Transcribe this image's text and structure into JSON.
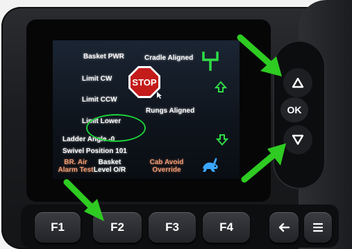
{
  "screen": {
    "labels": {
      "basket_pwr": "Basket PWR",
      "cradle_aligned": "Cradle Aligned",
      "limit_cw": "Limit CW",
      "limit_ccw": "Limit CCW",
      "limit_lower": "Limit Lower",
      "rungs_aligned": "Rungs Aligned",
      "ladder_angle": "Ladder Angle -0",
      "swivel_position": "Swivel Position 101",
      "stop_sign": "STOP"
    },
    "soft_keys": {
      "f1_line1": "BR. Air",
      "f1_line2": "Alarm Test",
      "f2_line1": "Basket",
      "f2_line2": "Level O/R",
      "f3_line1": "Cab Avoid",
      "f3_line2": "Override"
    }
  },
  "nav": {
    "ok": "OK"
  },
  "function_keys": {
    "f1": "F1",
    "f2": "F2",
    "f3": "F3",
    "f4": "F4"
  },
  "colors": {
    "indicator_green": "#2fdc47",
    "stop_red": "#c41b1b",
    "label_orange": "#f09a73",
    "annotation_arrow": "#2ecb22"
  }
}
